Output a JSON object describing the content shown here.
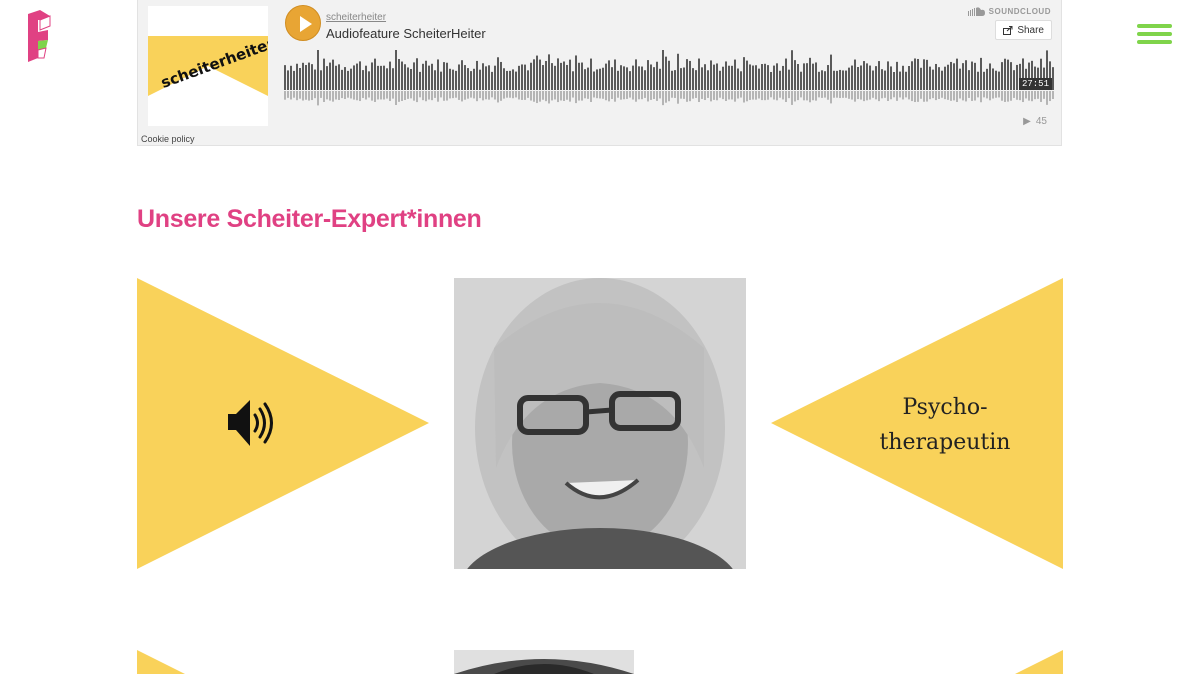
{
  "header": {
    "logo_icon": "f-logo-icon",
    "menu_icon": "hamburger-menu-icon",
    "menu_color": "#7fd44b"
  },
  "soundcloud": {
    "artwork_text": "scheiterheiter",
    "username": "scheiterheiter",
    "track_title": "Audiofeature ScheiterHeiter",
    "brand": "SOUNDCLOUD",
    "share_label": "Share",
    "duration": "27:51",
    "plays": "45",
    "cookie_policy": "Cookie policy",
    "accent_color": "#e8a534"
  },
  "experts": {
    "title": "Unsere Scheiter-Expert*innen",
    "title_color": "#e04183",
    "triangle_color": "#f9d25a",
    "items": [
      {
        "audio_icon": "speaker-icon",
        "role_lines": [
          "Psycho-",
          "therapeutin"
        ]
      }
    ]
  }
}
